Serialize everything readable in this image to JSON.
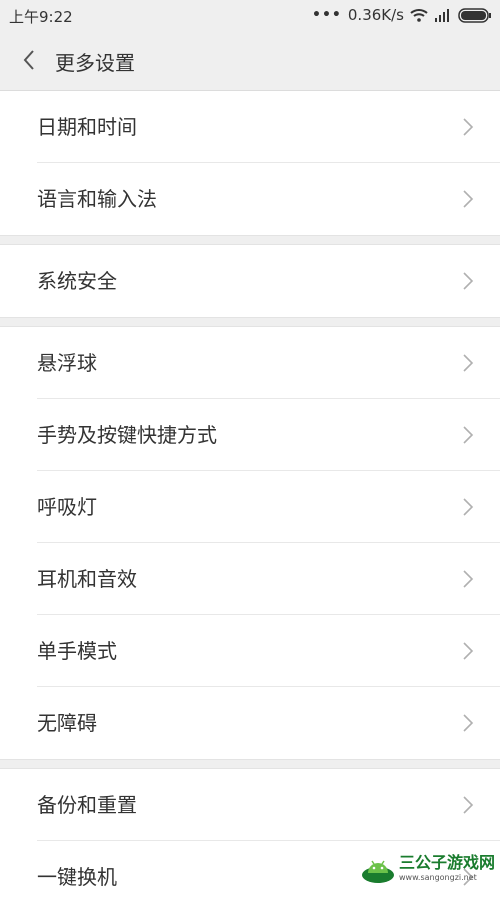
{
  "status_bar": {
    "time": "上午9:22",
    "network_speed": "0.36K/s",
    "icons": [
      "more-dots-icon",
      "wifi-icon",
      "signal-icon",
      "battery-icon"
    ]
  },
  "header": {
    "back_icon": "chevron-left-icon",
    "title": "更多设置"
  },
  "groups": [
    {
      "items": [
        {
          "label": "日期和时间"
        },
        {
          "label": "语言和输入法"
        }
      ]
    },
    {
      "items": [
        {
          "label": "系统安全"
        }
      ]
    },
    {
      "items": [
        {
          "label": "悬浮球"
        },
        {
          "label": "手势及按键快捷方式"
        },
        {
          "label": "呼吸灯"
        },
        {
          "label": "耳机和音效"
        },
        {
          "label": "单手模式"
        },
        {
          "label": "无障碍"
        }
      ]
    },
    {
      "items": [
        {
          "label": "备份和重置"
        },
        {
          "label": "一键换机"
        }
      ]
    }
  ],
  "watermark": {
    "title": "三公子游戏网",
    "url": "www.sangongzi.net"
  },
  "colors": {
    "background": "#efefef",
    "list_background": "#ffffff",
    "text": "#333333",
    "chevron": "#b0b0b0",
    "watermark_green": "#1a7c2e"
  }
}
